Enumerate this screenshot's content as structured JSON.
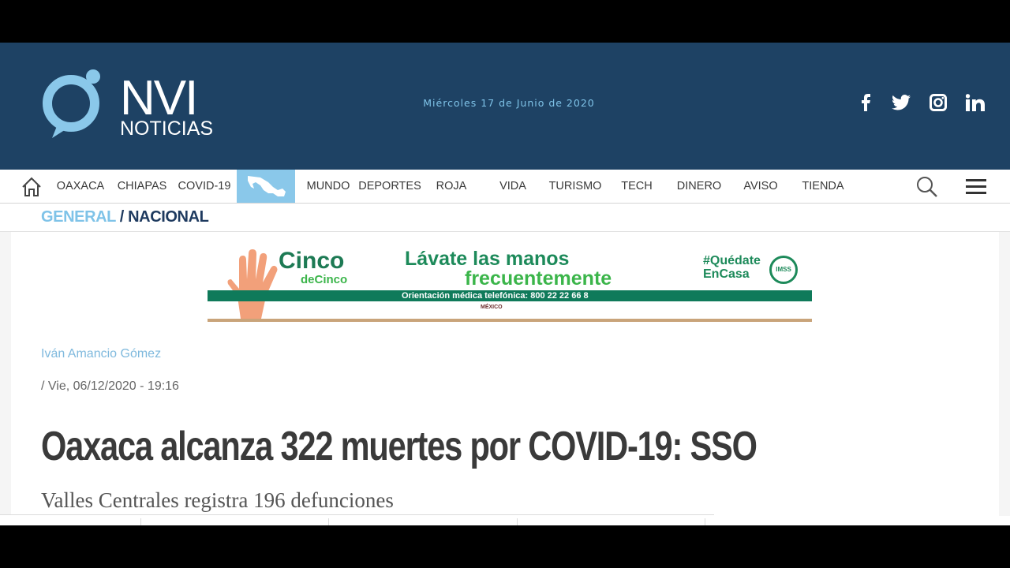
{
  "header": {
    "logo_text": "NVI NOTICIAS",
    "date": "Miércoles 17 de Junio de 2020",
    "social": [
      "facebook-icon",
      "twitter-icon",
      "instagram-icon",
      "linkedin-icon"
    ]
  },
  "nav": {
    "items": [
      "OAXACA",
      "CHIAPAS",
      "COVID-19",
      "MUNDO",
      "DEPORTES",
      "ROJA",
      "VIDA",
      "TURISMO",
      "TECH",
      "DINERO",
      "AVISO",
      "TIENDA"
    ]
  },
  "breadcrumb": {
    "section": "GENERAL",
    "separator": " / ",
    "subsection": "NACIONAL"
  },
  "banner": {
    "cinco": "Cinco",
    "de_cinco": "deCinco",
    "title_line1": "Lávate las manos",
    "title_line2": "frecuentemente",
    "hashtag_line1": "#Quédate",
    "hashtag_line2": "EnCasa",
    "imss": "IMSS",
    "phone_strip": "Orientación médica telefónica: 800 22 22 66 8",
    "footer": "MÉXICO"
  },
  "article": {
    "author": "Iván Amancio Gómez",
    "dateline": "/  Vie, 06/12/2020 - 19:16",
    "headline": "Oaxaca alcanza 322 muertes por COVID-19: SSO",
    "subhead": "Valles Centrales registra 196 defunciones"
  },
  "colors": {
    "header_bg": "#1e4264",
    "accent": "#7fc3e8",
    "map_tab": "#8ac8ea"
  }
}
